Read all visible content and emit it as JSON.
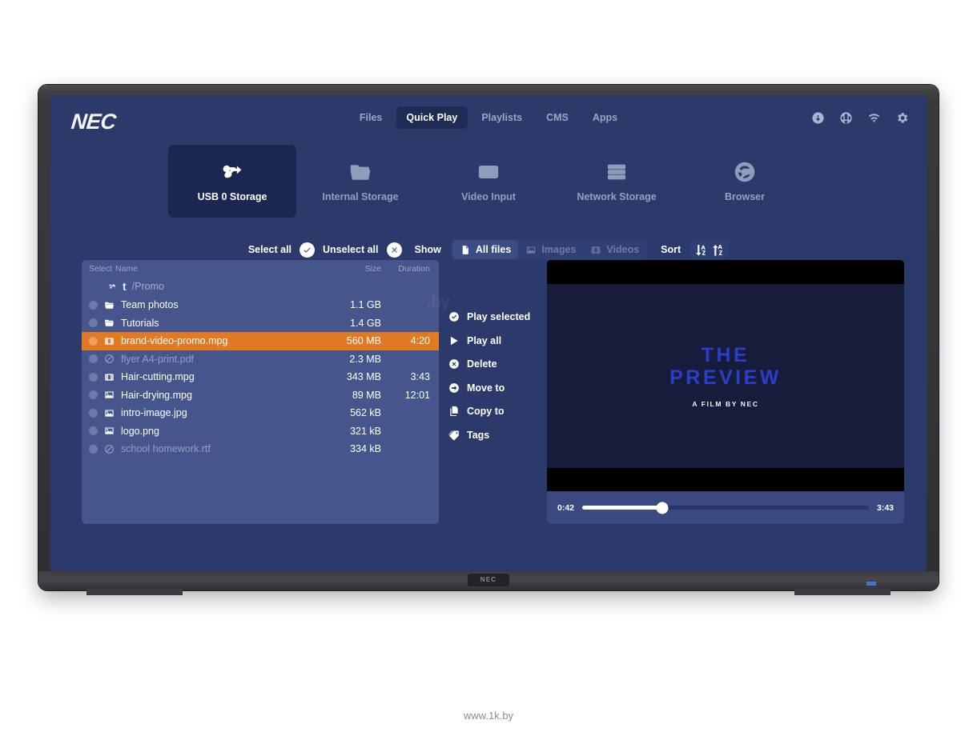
{
  "brand": {
    "logo": "NEC",
    "bezel_badge": "NEC"
  },
  "watermark": {
    "text": "www.1k.by",
    "ghost": ".by"
  },
  "nav": {
    "items": [
      {
        "label": "Files",
        "active": false
      },
      {
        "label": "Quick Play",
        "active": true
      },
      {
        "label": "Playlists",
        "active": false
      },
      {
        "label": "CMS",
        "active": false
      },
      {
        "label": "Apps",
        "active": false
      }
    ]
  },
  "system_icons": [
    {
      "name": "download-icon"
    },
    {
      "name": "globe-icon"
    },
    {
      "name": "wifi-icon"
    },
    {
      "name": "gear-icon"
    }
  ],
  "sources": [
    {
      "label": "USB 0 Storage",
      "icon": "usb-icon",
      "active": true
    },
    {
      "label": "Internal Storage",
      "icon": "folder-icon",
      "active": false
    },
    {
      "label": "Video Input",
      "icon": "video-input-icon",
      "active": false
    },
    {
      "label": "Network Storage",
      "icon": "server-icon",
      "active": false
    },
    {
      "label": "Browser",
      "icon": "browser-icon",
      "active": false
    }
  ],
  "toolbar": {
    "select_all": "Select all",
    "unselect_all": "Unselect all",
    "show_label": "Show",
    "sort_label": "Sort",
    "filters": [
      {
        "label": "All files",
        "icon": "document-icon",
        "active": true
      },
      {
        "label": "Images",
        "icon": "image-icon",
        "active": false
      },
      {
        "label": "Videos",
        "icon": "film-icon",
        "active": false
      }
    ],
    "sort_buttons": [
      {
        "name": "sort-descending-az-button"
      },
      {
        "name": "sort-ascending-az-button"
      }
    ]
  },
  "filelist": {
    "columns": {
      "select": "Select",
      "name": "Name",
      "size": "Size",
      "duration": "Duration"
    },
    "breadcrumb": {
      "up": "t",
      "path": "/Promo"
    },
    "rows": [
      {
        "name": "Team photos",
        "size": "1.1 GB",
        "duration": "",
        "icon": "folder-icon",
        "selected": false,
        "disabled": false
      },
      {
        "name": "Tutorials",
        "size": "1.4 GB",
        "duration": "",
        "icon": "folder-icon",
        "selected": false,
        "disabled": false
      },
      {
        "name": "brand-video-promo.mpg",
        "size": "560 MB",
        "duration": "4:20",
        "icon": "film-icon",
        "selected": true,
        "disabled": false
      },
      {
        "name": "flyer A4-print.pdf",
        "size": "2.3 MB",
        "duration": "",
        "icon": "blocked-icon",
        "selected": false,
        "disabled": true
      },
      {
        "name": "Hair-cutting.mpg",
        "size": "343 MB",
        "duration": "3:43",
        "icon": "film-icon",
        "selected": false,
        "disabled": false
      },
      {
        "name": "Hair-drying.mpg",
        "size": "89 MB",
        "duration": "12:01",
        "icon": "image-icon",
        "selected": false,
        "disabled": false
      },
      {
        "name": "intro-image.jpg",
        "size": "562 kB",
        "duration": "",
        "icon": "image-icon",
        "selected": false,
        "disabled": false
      },
      {
        "name": "logo.png",
        "size": "321 kB",
        "duration": "",
        "icon": "image-icon",
        "selected": false,
        "disabled": false
      },
      {
        "name": "school homework.rtf",
        "size": "334 kB",
        "duration": "",
        "icon": "blocked-icon",
        "selected": false,
        "disabled": true
      }
    ]
  },
  "actions": [
    {
      "label": "Play selected",
      "icon": "check-circle-icon"
    },
    {
      "label": "Play all",
      "icon": "play-icon"
    },
    {
      "label": "Delete",
      "icon": "x-circle-icon"
    },
    {
      "label": "Move to",
      "icon": "arrow-circle-icon"
    },
    {
      "label": "Copy to",
      "icon": "copy-icon"
    },
    {
      "label": "Tags",
      "icon": "tag-icon"
    }
  ],
  "preview": {
    "title_line1": "THE",
    "title_line2": "PREVIEW",
    "subtitle": "A FILM BY NEC",
    "elapsed": "0:42",
    "total": "3:43",
    "progress_percent": 28
  },
  "colors": {
    "screen_bg": "#2b3a6b",
    "accent_selected": "#e07b24",
    "panel_bg": "#46568c",
    "active_tile": "#1b2750",
    "title_blue": "#2b3ecb"
  }
}
